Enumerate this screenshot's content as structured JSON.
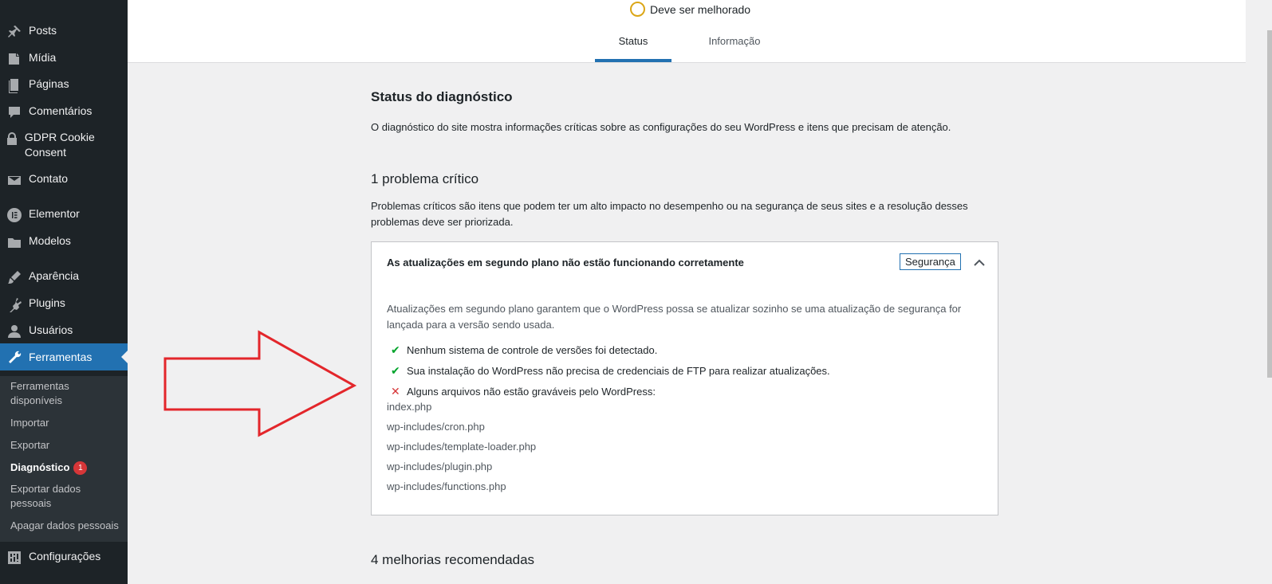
{
  "sidebar": {
    "items": [
      {
        "label": "Posts"
      },
      {
        "label": "Mídia"
      },
      {
        "label": "Páginas"
      },
      {
        "label": "Comentários"
      },
      {
        "label": "GDPR Cookie Consent"
      },
      {
        "label": "Contato"
      },
      {
        "label": "Elementor"
      },
      {
        "label": "Modelos"
      },
      {
        "label": "Aparência"
      },
      {
        "label": "Plugins"
      },
      {
        "label": "Usuários"
      },
      {
        "label": "Ferramentas"
      },
      {
        "label": "Configurações"
      }
    ],
    "submenu": [
      {
        "label": "Ferramentas disponíveis"
      },
      {
        "label": "Importar"
      },
      {
        "label": "Exportar"
      },
      {
        "label": "Diagnóstico",
        "badge": "1"
      },
      {
        "label": "Exportar dados pessoais"
      },
      {
        "label": "Apagar dados pessoais"
      }
    ]
  },
  "header": {
    "score_label": "Deve ser melhorado",
    "tabs": [
      {
        "label": "Status"
      },
      {
        "label": "Informação"
      }
    ]
  },
  "main": {
    "title": "Status do diagnóstico",
    "description": "O diagnóstico do site mostra informações críticas sobre as configurações do seu WordPress e itens que precisam de atenção.",
    "critical_heading": "1 problema crítico",
    "critical_description": "Problemas críticos são itens que podem ter um alto impacto no desempenho ou na segurança de seus sites e a resolução desses problemas deve ser priorizada.",
    "issue": {
      "title": "As atualizações em segundo plano não estão funcionando corretamente",
      "badge": "Segurança",
      "body": "Atualizações em segundo plano garantem que o WordPress possa se atualizar sozinho se uma atualização de segurança for lançada para a versão sendo usada.",
      "checks": [
        {
          "mark": "✔",
          "text": "Nenhum sistema de controle de versões foi detectado."
        },
        {
          "mark": "✔",
          "text": "Sua instalação do WordPress não precisa de credenciais de FTP para realizar atualizações."
        },
        {
          "mark": "✕",
          "text": "Alguns arquivos não estão graváveis pelo WordPress:"
        }
      ],
      "files": [
        "index.php",
        "wp-includes/cron.php",
        "wp-includes/template-loader.php",
        "wp-includes/plugin.php",
        "wp-includes/functions.php"
      ]
    },
    "recommended_heading": "4 melhorias recomendadas"
  },
  "colors": {
    "sidebar_bg": "#1d2327",
    "accent": "#2271b1",
    "ok": "#00a32a",
    "error": "#d63638",
    "score_ring": "#dba617",
    "arrow": "#e3262b"
  }
}
